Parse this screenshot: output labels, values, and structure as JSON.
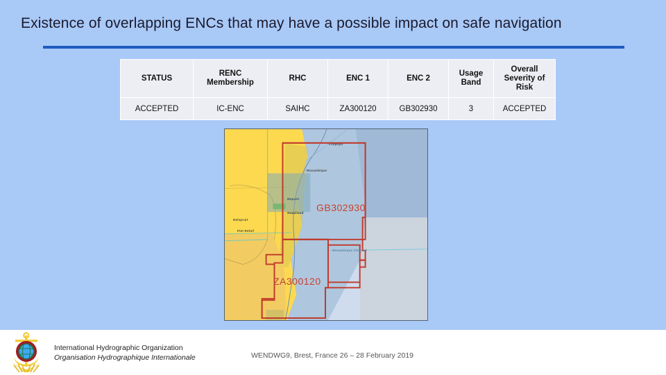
{
  "slide": {
    "title": "Existence of overlapping ENCs that may have a possible impact on safe navigation",
    "accent_rule_color": "#1f5bbf",
    "background_color": "#a9c9f7"
  },
  "table": {
    "name": "overlapping-enc-risk-table",
    "headers": [
      "STATUS",
      "RENC Membership",
      "RHC",
      "ENC 1",
      "ENC 2",
      "Usage Band",
      "Overall Severity of Risk"
    ],
    "headers_lines": {
      "status": "STATUS",
      "renc_membership_line1": "RENC",
      "renc_membership_line2": "Membership",
      "rhc": "RHC",
      "enc1": "ENC 1",
      "enc2": "ENC 2",
      "usage_band_line1": "Usage",
      "usage_band_line2": "Band",
      "overall_line1": "Overall",
      "overall_line2": "Severity of",
      "overall_line3": "Risk"
    },
    "rows": [
      {
        "status": "ACCEPTED",
        "status_color": "#c00000",
        "renc_membership": "IC-ENC",
        "rhc": "SAIHC",
        "enc1": "ZA300120",
        "enc2": "GB302930",
        "usage_band": "3",
        "overall_severity_of_risk": "ACCEPTED"
      }
    ]
  },
  "map": {
    "name": "enc-overlap-map",
    "enc1_label": "ZA300120",
    "enc2_label": "GB302930",
    "label_color": "#c0392b",
    "places": {
      "country": "Mozambique",
      "river": "Limpopo",
      "channel": "Mozambique Channel",
      "capital": "Maputo",
      "city1": "Nelspruit",
      "city2": "Piet Retief",
      "swaziland": "Swaziland"
    }
  },
  "footer": {
    "organization_en": "International Hydrographic Organization",
    "organization_fr": "Organisation Hydrographique Internationale",
    "event": "WENDWG9, Brest, France 26 – 28 February 2019",
    "logo_name": "iho-logo"
  }
}
